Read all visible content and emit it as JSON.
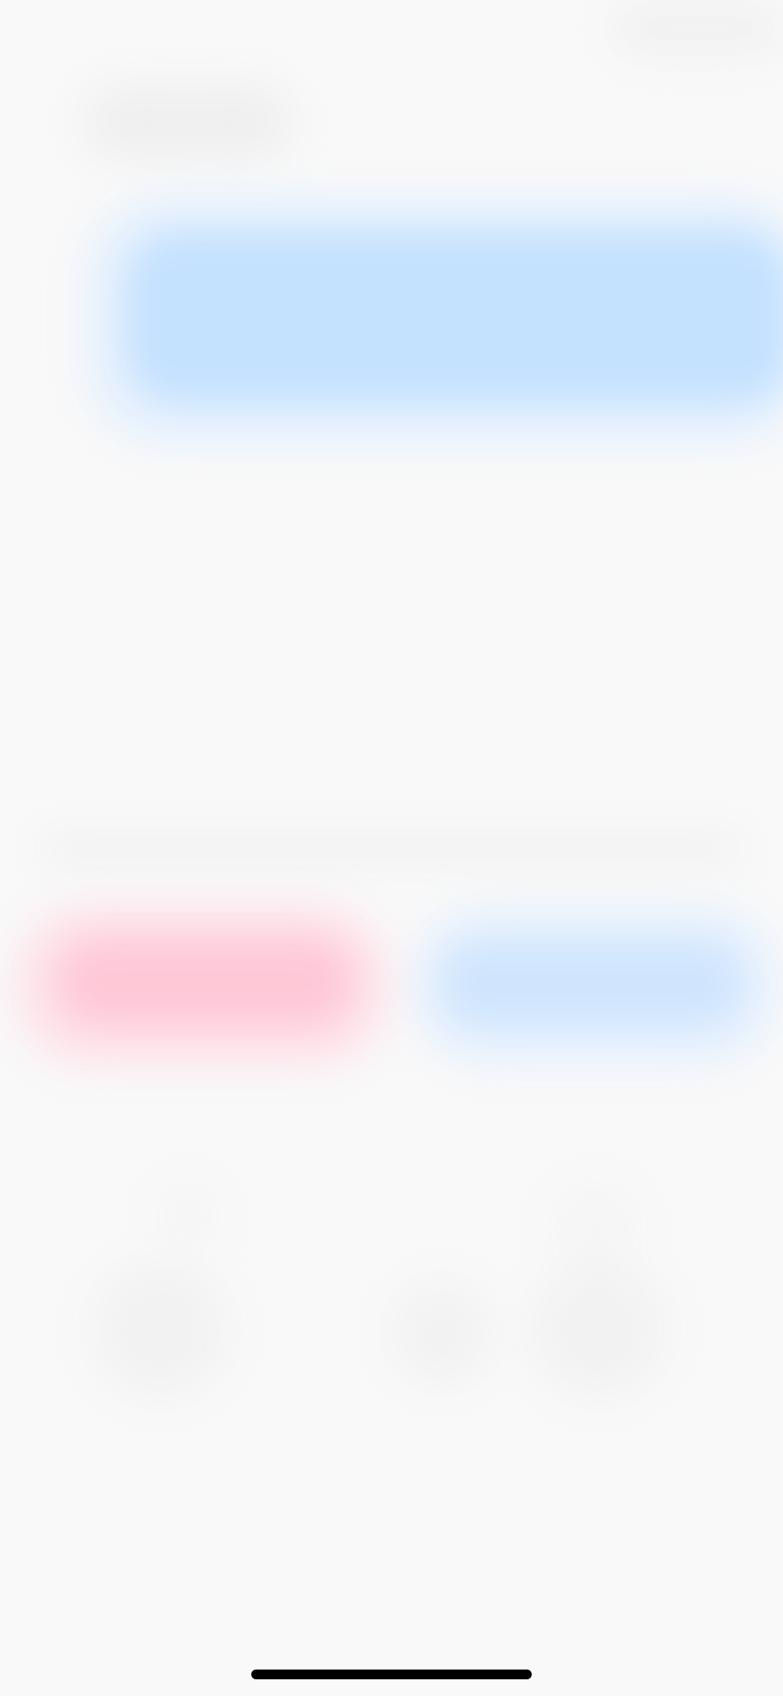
{
  "screen": {
    "state": "blurred",
    "background_color": "#f9f9f9"
  },
  "colors": {
    "banner_blue": "#c4e1fe",
    "decline_pink": "#fec8d7",
    "accept_blue": "#cfe5fd",
    "home_indicator": "#000000"
  },
  "icons": {
    "control_1": "circle-control-icon",
    "control_2": "circle-control-icon",
    "control_3": "circle-control-icon"
  }
}
